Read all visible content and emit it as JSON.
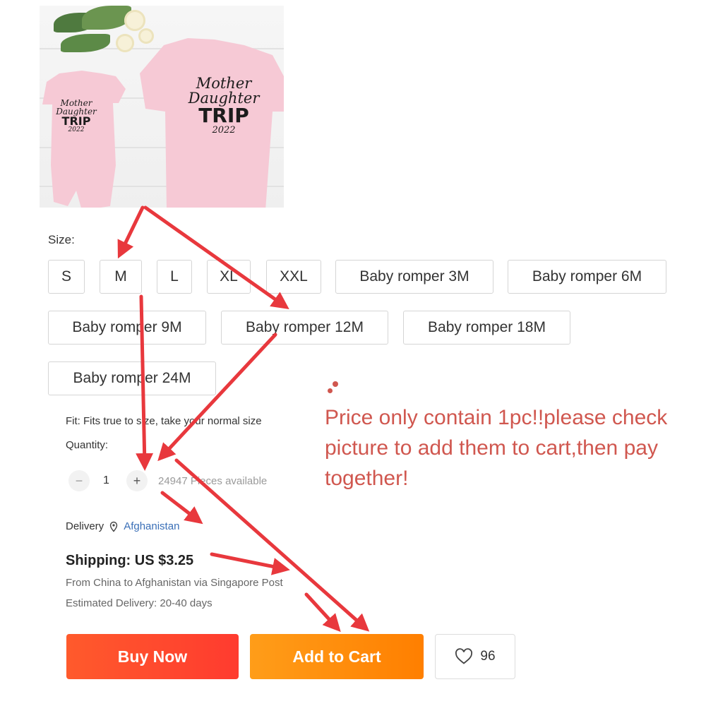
{
  "product": {
    "photo_alt": "",
    "small_shirt_text": {
      "line1": "Mother",
      "line2": "Daughter",
      "line3": "TRIP",
      "line4": "2022"
    },
    "large_shirt_text": {
      "line1": "Mother",
      "line2": "Daughter",
      "line3": "TRIP",
      "line4": "2022"
    }
  },
  "size": {
    "label": "Size:",
    "options": [
      "S",
      "M",
      "L",
      "XL",
      "XXL",
      "Baby romper 3M",
      "Baby romper 6M",
      "Baby romper 9M",
      "Baby romper 12M",
      "Baby romper 18M",
      "Baby romper 24M"
    ]
  },
  "fit": {
    "text": "Fit: Fits true to size, take your normal size"
  },
  "quantity": {
    "label": "Quantity:",
    "minus": "−",
    "value": "1",
    "plus": "+",
    "available": "24947 Pieces available"
  },
  "delivery": {
    "label": "Delivery",
    "country": "Afghanistan"
  },
  "shipping": {
    "title": "Shipping: US $3.25",
    "route": "From China to Afghanistan via Singapore Post",
    "estimate": "Estimated Delivery: 20-40 days"
  },
  "note": {
    "text": "Price only contain 1pc!!please check picture to add them to cart,then pay together!"
  },
  "actions": {
    "buy_now": "Buy Now",
    "add_to_cart": "Add to Cart",
    "wishlist_count": "96"
  },
  "colors": {
    "buy_now": "#ff4a2e",
    "add_to_cart": "#ff8f0d",
    "arrow": "#e8383d",
    "note": "#d0574f",
    "shirt": "#f6c9d5"
  },
  "icons": {
    "location": "location-pin-icon",
    "heart": "heart-icon"
  }
}
